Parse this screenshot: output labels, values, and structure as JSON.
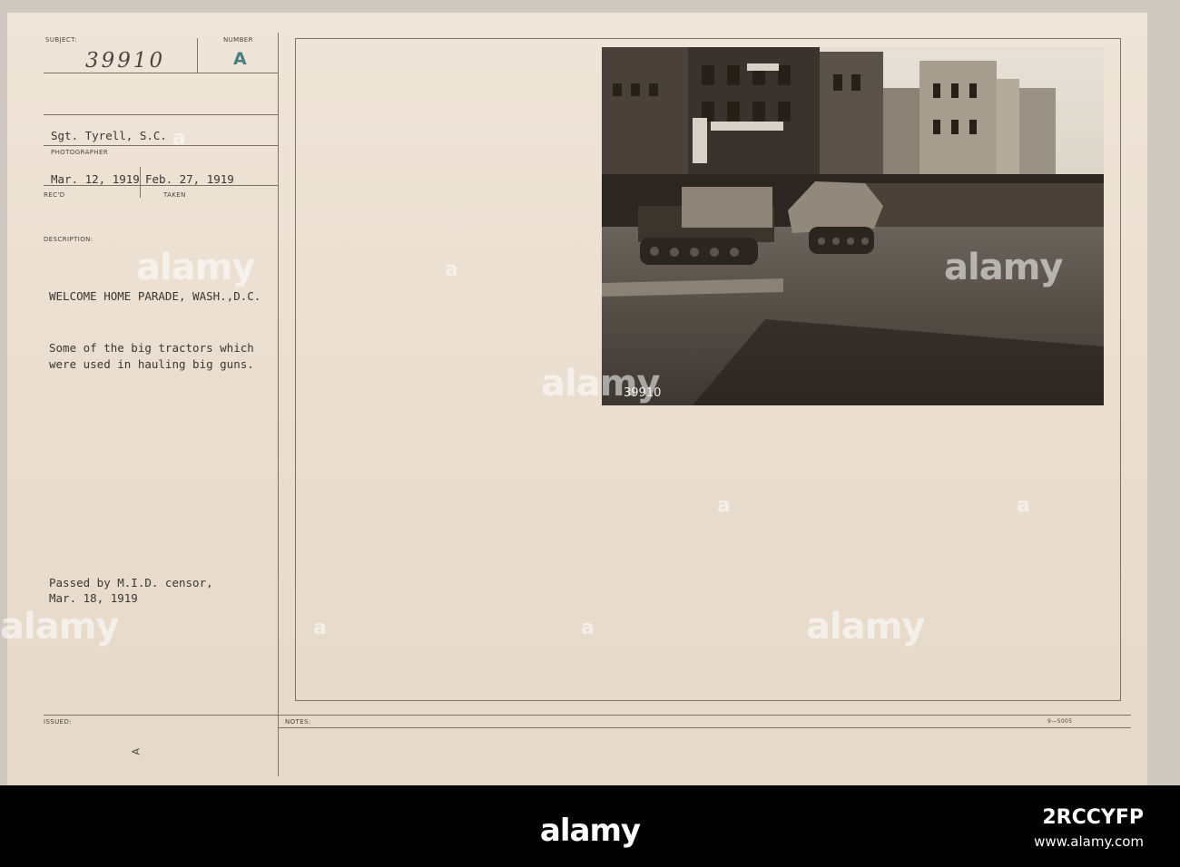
{
  "card": {
    "subject_label": "SUBJECT:",
    "subject_value": "39910",
    "number_label": "NUMBER",
    "number_value": "A",
    "photographer_value": "Sgt. Tyrell, S.C.",
    "photographer_label": "PHOTOGRAPHER",
    "received_value": "Mar. 12, 1919",
    "received_label": "REC'D",
    "taken_value": "Feb. 27, 1919",
    "taken_label": "TAKEN",
    "description_label": "DESCRIPTION:",
    "title": "WELCOME HOME PARADE, WASH.,D.C.",
    "description_line1": "Some of the big tractors which",
    "description_line2": "were used in hauling big guns.",
    "censor_line1": "Passed by M.I.D. censor,",
    "censor_line2": "Mar. 18, 1919",
    "issued_label": "ISSUED:",
    "notes_label": "NOTES:",
    "form_number": "9—5005",
    "bottom_mark": "A"
  },
  "photo": {
    "negative_number": "39910"
  },
  "watermark": {
    "logo": "alamy",
    "image_id": "2RCCYFP",
    "url": "www.alamy.com"
  }
}
